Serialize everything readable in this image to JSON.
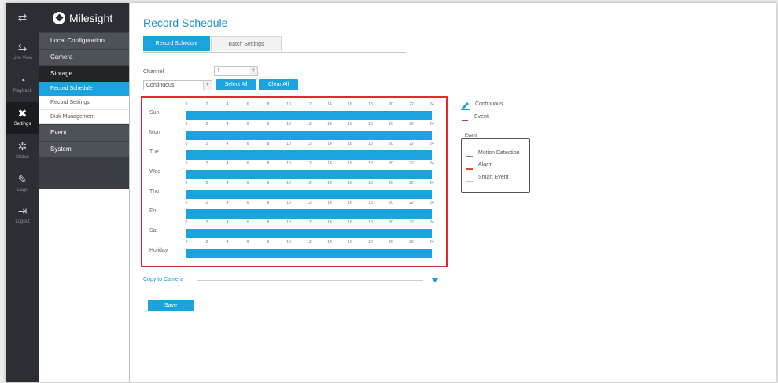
{
  "rail": [
    {
      "icon": "exchange-icon",
      "glyph": "⇄",
      "label": ""
    },
    {
      "icon": "live-view-icon",
      "glyph": "⇆",
      "label": "Live View"
    },
    {
      "icon": "playback-icon",
      "glyph": "◔",
      "label": "Playback"
    },
    {
      "icon": "settings-icon",
      "glyph": "✖",
      "label": "Settings"
    },
    {
      "icon": "status-icon",
      "glyph": "✲",
      "label": "Status"
    },
    {
      "icon": "logs-icon",
      "glyph": "✎",
      "label": "Logs"
    },
    {
      "icon": "logout-icon",
      "glyph": "⇥",
      "label": "Logout"
    }
  ],
  "brand": {
    "name": "Milesight"
  },
  "menu": {
    "local_configuration": "Local Configuration",
    "camera": "Camera",
    "storage": "Storage",
    "record_schedule": "Record Schedule",
    "record_settings": "Record Settings",
    "disk_management": "Disk Management",
    "event": "Event",
    "system": "System"
  },
  "page": {
    "title": "Record Schedule"
  },
  "tabs": {
    "record_schedule": "Record Schedule",
    "batch_settings": "Batch Settings"
  },
  "form": {
    "channel_label": "Channel",
    "channel_value": "1",
    "mode_value": "Continuous",
    "select_all": "Select All",
    "clear_all": "Clear All"
  },
  "schedule": {
    "ticks": [
      "0",
      "2",
      "4",
      "6",
      "8",
      "10",
      "12",
      "14",
      "16",
      "18",
      "20",
      "22",
      "24"
    ],
    "days": [
      "Sun",
      "Mon",
      "Tue",
      "Wed",
      "Thu",
      "Fri",
      "Sat",
      "Holiday"
    ],
    "coverage_fraction": 1.0
  },
  "legend": {
    "continuous": "Continuous",
    "event": "Event",
    "event_group_title": "Event",
    "motion_detection": "Motion Detection",
    "alarm": "Alarm",
    "smart_event": "Smart Event"
  },
  "colors": {
    "accent": "#1aa3dc",
    "continuous": "#1aa3dc",
    "event": "#b4329a",
    "motion_detection": "#3fae49",
    "alarm": "#e8452c",
    "smart_event": "#f4b6c8",
    "highlight_border": "#e32a2a"
  },
  "copy": {
    "label": "Copy to Camera"
  },
  "actions": {
    "save": "Save"
  }
}
